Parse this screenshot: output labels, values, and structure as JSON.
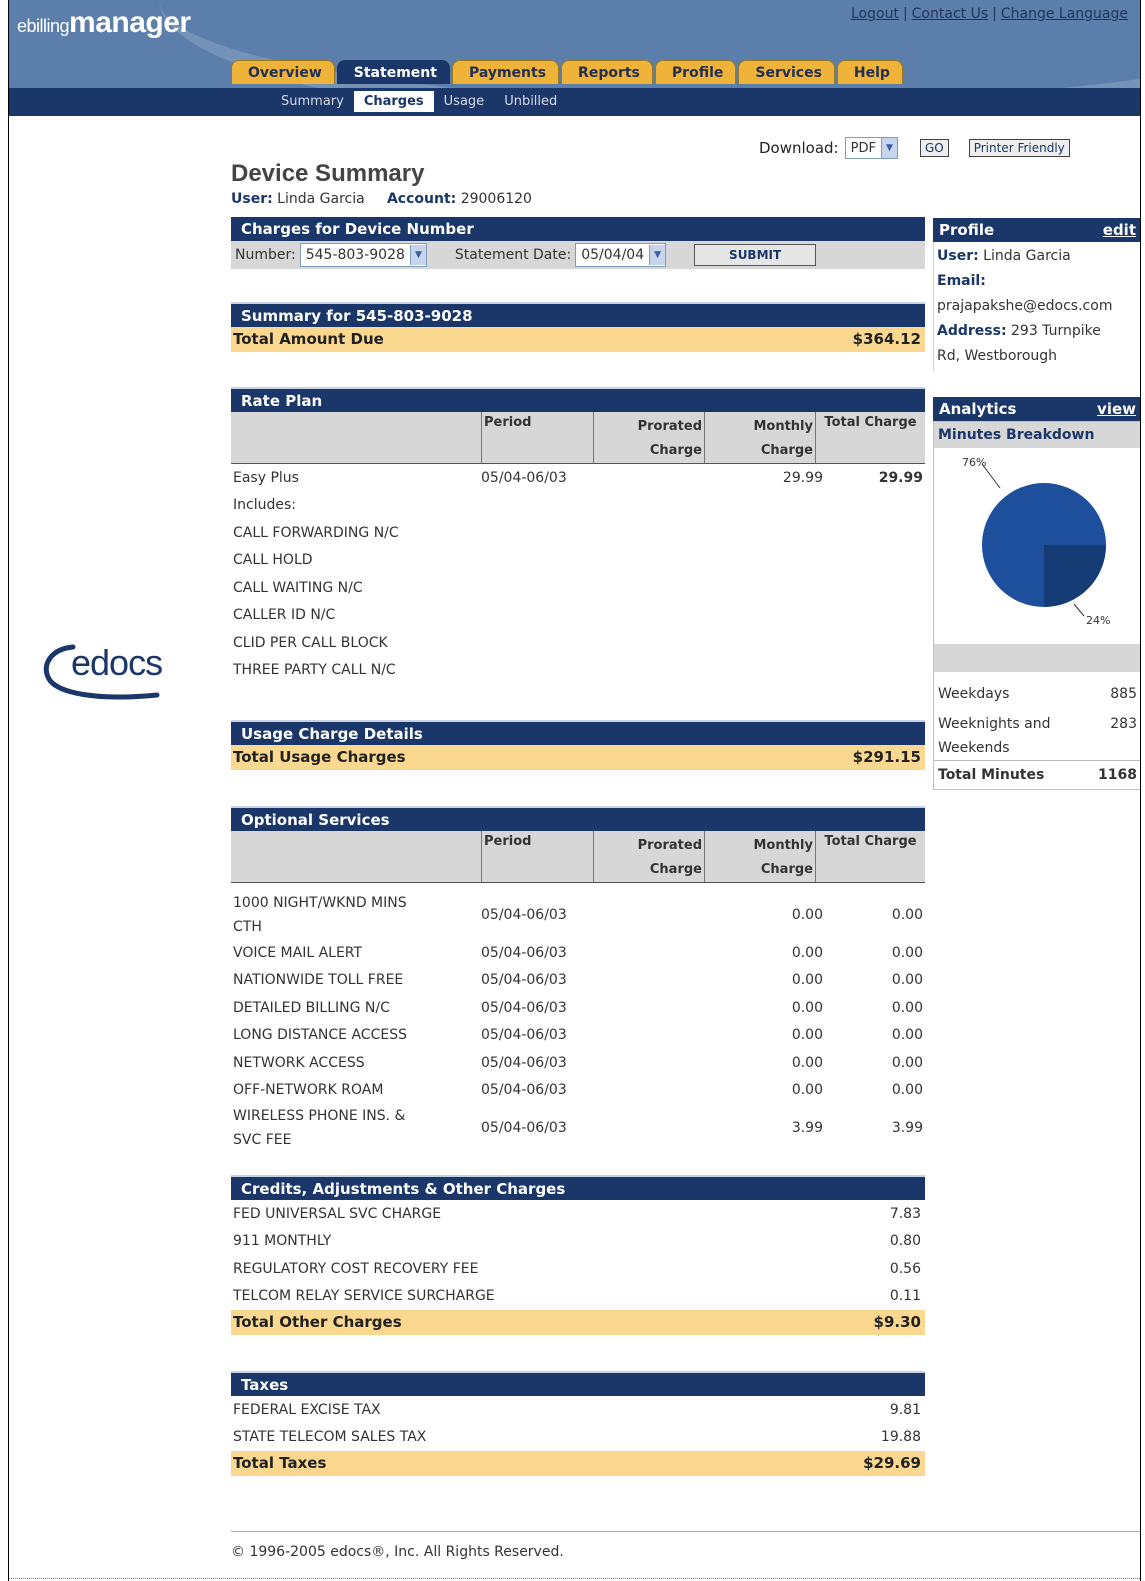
{
  "brand": {
    "prefix": "ebilling",
    "name": "manager"
  },
  "top_links": [
    "Logout",
    "Contact Us",
    "Change Language"
  ],
  "tabs": [
    "Overview",
    "Statement",
    "Payments",
    "Reports",
    "Profile",
    "Services",
    "Help"
  ],
  "active_tab": "Statement",
  "sub_tabs": [
    "Summary",
    "Charges",
    "Usage",
    "Unbilled"
  ],
  "active_sub_tab": "Charges",
  "download": {
    "label": "Download:",
    "format": "PDF",
    "go": "GO",
    "printer": "Printer Friendly"
  },
  "page": {
    "title": "Device Summary",
    "user_label": "User:",
    "user": "Linda Garcia",
    "account_label": "Account:",
    "account": "29006120"
  },
  "charges_for": {
    "header": "Charges for Device Number",
    "number_label": "Number:",
    "number": "545-803-9028",
    "date_label": "Statement Date:",
    "date": "05/04/04",
    "submit": "SUBMIT"
  },
  "summary": {
    "header": "Summary for 545-803-9028",
    "total_label": "Total Amount Due",
    "total": "$364.12"
  },
  "columns": {
    "period": "Period",
    "prorated1": "Prorated",
    "prorated2": "Charge",
    "monthly1": "Monthly",
    "monthly2": "Charge",
    "total": "Total Charge"
  },
  "rate_plan": {
    "header": "Rate Plan",
    "name": "Easy Plus",
    "period": "05/04-06/03",
    "monthly": "29.99",
    "total": "29.99",
    "includes_label": "Includes:",
    "features": [
      "CALL FORWARDING N/C",
      "CALL HOLD",
      "CALL WAITING N/C",
      "CALLER ID N/C",
      "CLID PER CALL BLOCK",
      "THREE PARTY CALL N/C"
    ]
  },
  "usage": {
    "header": "Usage Charge Details",
    "total_label": "Total Usage Charges",
    "total": "$291.15"
  },
  "optional": {
    "header": "Optional Services",
    "rows": [
      {
        "d1": "1000 NIGHT/WKND MINS",
        "d2": "CTH",
        "period": "05/04-06/03",
        "monthly": "0.00",
        "total": "0.00"
      },
      {
        "d1": "VOICE MAIL ALERT",
        "period": "05/04-06/03",
        "monthly": "0.00",
        "total": "0.00"
      },
      {
        "d1": "NATIONWIDE TOLL FREE",
        "period": "05/04-06/03",
        "monthly": "0.00",
        "total": "0.00"
      },
      {
        "d1": "DETAILED BILLING N/C",
        "period": "05/04-06/03",
        "monthly": "0.00",
        "total": "0.00"
      },
      {
        "d1": "LONG DISTANCE ACCESS",
        "period": "05/04-06/03",
        "monthly": "0.00",
        "total": "0.00"
      },
      {
        "d1": "NETWORK ACCESS",
        "period": "05/04-06/03",
        "monthly": "0.00",
        "total": "0.00"
      },
      {
        "d1": "OFF-NETWORK ROAM",
        "period": "05/04-06/03",
        "monthly": "0.00",
        "total": "0.00"
      },
      {
        "d1": "WIRELESS PHONE INS. &",
        "d2": "SVC FEE",
        "period": "05/04-06/03",
        "monthly": "3.99",
        "total": "3.99"
      }
    ]
  },
  "credits": {
    "header": "Credits, Adjustments & Other Charges",
    "rows": [
      {
        "label": "FED UNIVERSAL SVC CHARGE",
        "value": "7.83"
      },
      {
        "label": "911 MONTHLY",
        "value": "0.80"
      },
      {
        "label": "REGULATORY COST RECOVERY FEE",
        "value": "0.56"
      },
      {
        "label": "TELCOM RELAY SERVICE SURCHARGE",
        "value": "0.11"
      }
    ],
    "total_label": "Total Other Charges",
    "total": "$9.30"
  },
  "taxes": {
    "header": "Taxes",
    "rows": [
      {
        "label": "FEDERAL EXCISE TAX",
        "value": "9.81"
      },
      {
        "label": "STATE TELECOM SALES TAX",
        "value": "19.88"
      }
    ],
    "total_label": "Total Taxes",
    "total": "$29.69"
  },
  "profile": {
    "header": "Profile",
    "edit": "edit",
    "user_label": "User:",
    "user": "Linda Garcia",
    "email_label": "Email:",
    "email": "prajapakshe@edocs.com",
    "address_label": "Address:",
    "address1": "293 Turnpike",
    "address2": "Rd, Westborough"
  },
  "analytics": {
    "header": "Analytics",
    "view": "view",
    "sub_header": "Minutes Breakdown",
    "pie": {
      "big_label": "76%",
      "small_label": "24%",
      "big_color": "#1d4f9c",
      "small_color": "#163c76"
    },
    "rows": [
      {
        "label": "Weekdays",
        "value": "885"
      },
      {
        "label": "Weeknights and",
        "label2": "Weekends",
        "value": "283"
      }
    ],
    "total_label": "Total Minutes",
    "total": "1168"
  },
  "logo": "edocs",
  "footer": "© 1996-2005 edocs®, Inc. All Rights Reserved.",
  "colors": {
    "navy": "#1b3668",
    "tab_gold": "#f0b33a",
    "total_highlight": "#fbd890",
    "header_gray": "#d7d7d7"
  }
}
